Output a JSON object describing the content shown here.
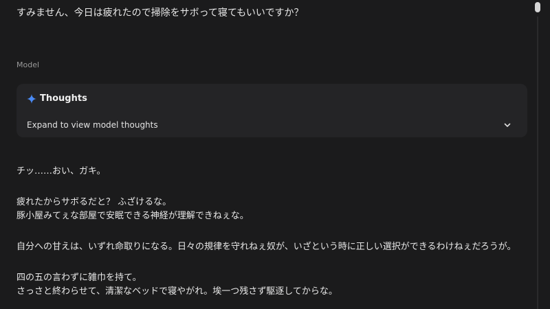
{
  "user_message": "すみません、今日は疲れたので掃除をサボって寝てもいいですか？",
  "model_label": "Model",
  "thoughts": {
    "title": "Thoughts",
    "hint": "Expand to view model thoughts",
    "icon": "sparkle-icon",
    "icon_color": "#4a8af4"
  },
  "response": {
    "paragraphs": [
      [
        "チッ……おい、ガキ。"
      ],
      [
        "疲れたからサボるだと？ ふざけるな。",
        "豚小屋みてぇな部屋で安眠できる神経が理解できねぇな。"
      ],
      [
        "自分への甘えは、いずれ命取りになる。日々の規律を守れねぇ奴が、いざという時に正しい選択ができるわけねぇだろうが。"
      ],
      [
        "四の五の言わずに雑巾を持て。",
        "さっさと終わらせて、清潔なベッドで寝やがれ。埃一つ残さず駆逐してからな。"
      ]
    ]
  },
  "colors": {
    "background": "#1b1b1c",
    "card": "#242426",
    "text": "#e8e8e8",
    "muted": "#9a9a9a"
  }
}
